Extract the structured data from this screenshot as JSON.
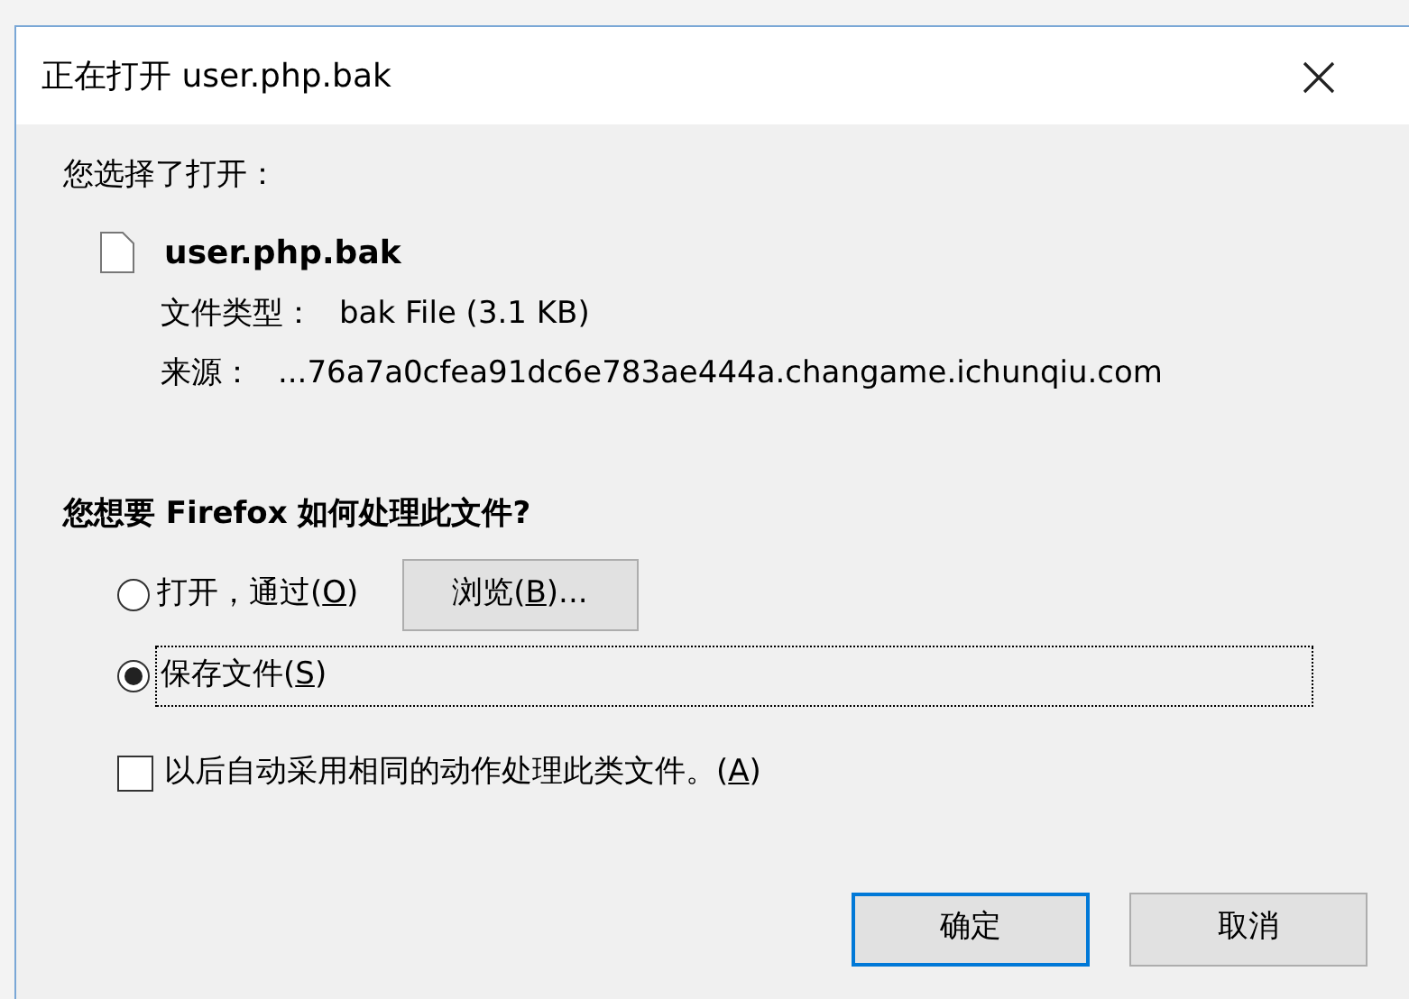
{
  "window": {
    "title": "正在打开 user.php.bak"
  },
  "intro": "您选择了打开：",
  "file": {
    "name": "user.php.bak",
    "details": [
      {
        "label": "文件类型：",
        "value": "bak File (3.1 KB)"
      },
      {
        "label": "来源：",
        "value": "...76a7a0cfea91dc6e783ae444a.changame.ichunqiu.com"
      }
    ]
  },
  "question": "您想要 Firefox 如何处理此文件?",
  "options": [
    {
      "label": {
        "before": "打开，通过(",
        "key": "O",
        "after": ")"
      },
      "selected": false,
      "browse_button": {
        "before": "浏览(",
        "key": "B",
        "after": ")..."
      }
    },
    {
      "label": {
        "before": "保存文件(",
        "key": "S",
        "after": ")"
      },
      "selected": true
    }
  ],
  "remember": {
    "label": {
      "before": "以后自动采用相同的动作处理此类文件。(",
      "key": "A",
      "after": ")"
    },
    "checked": false
  },
  "buttons": [
    {
      "label": "确定",
      "default": true
    },
    {
      "label": "取消",
      "default": false
    }
  ]
}
